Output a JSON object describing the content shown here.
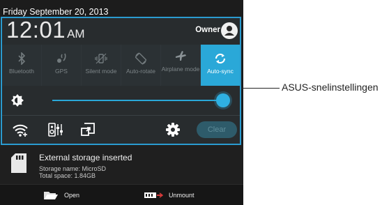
{
  "status_bar": {
    "date": "Friday September 20, 2013"
  },
  "quick_settings": {
    "clock": {
      "time": "12:01",
      "ampm": "AM"
    },
    "owner": "Owner",
    "toggles": [
      {
        "label": "Bluetooth",
        "icon": "bluetooth-icon",
        "active": false
      },
      {
        "label": "GPS",
        "icon": "gps-icon",
        "active": false
      },
      {
        "label": "Silent mode",
        "icon": "silent-mode-icon",
        "active": false
      },
      {
        "label": "Auto-rotate",
        "icon": "auto-rotate-icon",
        "active": false
      },
      {
        "label": "Airplane mode",
        "icon": "airplane-icon",
        "active": false
      },
      {
        "label": "Auto-sync",
        "icon": "sync-icon",
        "active": true
      }
    ],
    "brightness": {
      "level": 0.98
    },
    "bottom_icons": [
      "wifi-settings-icon",
      "audio-wizard-icon",
      "screen-cast-icon",
      "settings-gear-icon"
    ],
    "clear_label": "Clear"
  },
  "notification": {
    "icon": "sd-card-icon",
    "title": "External storage inserted",
    "line1": "Storage name: MicroSD",
    "line2": "Total space: 1.84GB"
  },
  "actions": {
    "open_label": "Open",
    "unmount_label": "Unmount"
  },
  "callout": {
    "label": "ASUS-snelinstellingen"
  },
  "colors": {
    "accent": "#2aa8d8",
    "panel": "#282c2e",
    "frame": "#2a9bd0"
  }
}
